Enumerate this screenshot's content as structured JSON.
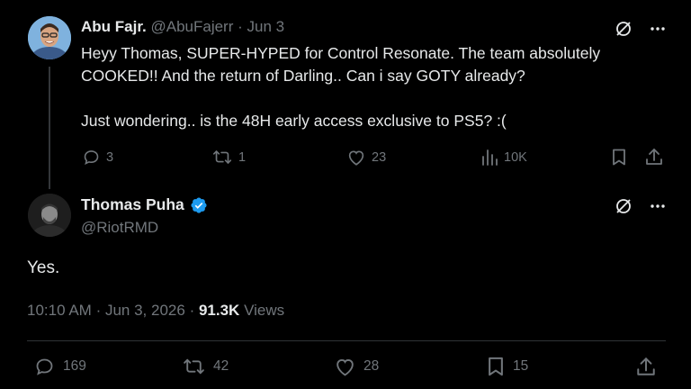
{
  "reply": {
    "author_name": "Abu Fajr.",
    "author_handle": "@AbuFajerr",
    "separator": "·",
    "date": "Jun 3",
    "lines": [
      "Heyy Thomas, SUPER-HYPED for Control Resonate. The team absolutely",
      "COOKED!! And the return of Darling.. Can i say GOTY already?"
    ],
    "line_after_gap": "Just wondering.. is the 48H early access exclusive to PS5? :(",
    "stats": {
      "replies": "3",
      "reposts": "1",
      "likes": "23",
      "views": "10K"
    },
    "icons": [
      "grok-icon",
      "more-icon",
      "reply-icon",
      "repost-icon",
      "like-icon",
      "views-icon",
      "bookmark-icon",
      "share-icon"
    ]
  },
  "main": {
    "author_name": "Thomas Puha",
    "author_handle": "@RiotRMD",
    "verified": true,
    "text": "Yes.",
    "time": "10:10 AM",
    "separator": "·",
    "date": "Jun 3, 2026",
    "separator2": "·",
    "views_count": "91.3K",
    "views_label": "Views",
    "stats": {
      "replies": "169",
      "reposts": "42",
      "likes": "28",
      "bookmarks": "15"
    }
  },
  "colors": {
    "background": "#000000",
    "text": "#e7e9ea",
    "secondary": "#71767b",
    "divider": "#2f3336",
    "verified": "#1d9bf0"
  }
}
